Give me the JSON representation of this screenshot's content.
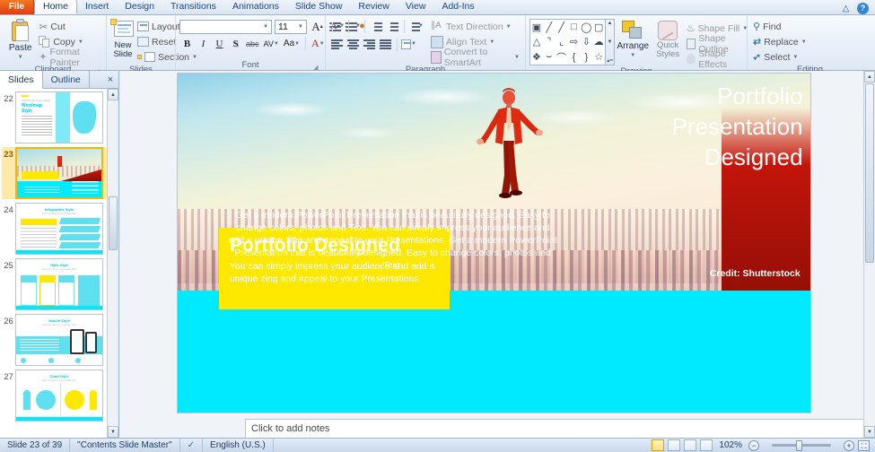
{
  "window": {
    "file_tab": "File",
    "minimize_ribbon_icon": "minimize-ribbon-icon",
    "help_icon": "help-icon"
  },
  "ribbon": {
    "tabs": [
      {
        "label": "Home",
        "active": true
      },
      {
        "label": "Insert",
        "active": false
      },
      {
        "label": "Design",
        "active": false
      },
      {
        "label": "Transitions",
        "active": false
      },
      {
        "label": "Animations",
        "active": false
      },
      {
        "label": "Slide Show",
        "active": false
      },
      {
        "label": "Review",
        "active": false
      },
      {
        "label": "View",
        "active": false
      },
      {
        "label": "Add-Ins",
        "active": false
      }
    ],
    "groups": {
      "clipboard": {
        "label": "Clipboard",
        "paste": "Paste",
        "cut": "Cut",
        "copy": "Copy",
        "format_painter": "Format Painter"
      },
      "slides": {
        "label": "Slides",
        "new_slide": "New\nSlide",
        "new_slide_line1": "New",
        "new_slide_line2": "Slide",
        "layout": "Layout",
        "reset": "Reset",
        "section": "Section"
      },
      "font": {
        "label": "Font",
        "font_name": "",
        "font_size": "11",
        "bold": "B",
        "italic": "I",
        "underline": "U",
        "shadow": "S",
        "strikethrough": "abc",
        "character_spacing": "AV",
        "change_case": "Aa",
        "font_color": "A",
        "grow_font": "A",
        "shrink_font": "A",
        "clear_formatting": "clear-formatting-icon"
      },
      "paragraph": {
        "label": "Paragraph",
        "text_direction": "Text Direction",
        "align_text": "Align Text",
        "convert_to_smartart": "Convert to SmartArt"
      },
      "drawing": {
        "label": "Drawing",
        "arrange": "Arrange",
        "quick_styles_line1": "Quick",
        "quick_styles_line2": "Styles",
        "shape_fill": "Shape Fill",
        "shape_outline": "Shape Outline",
        "shape_effects": "Shape Effects"
      },
      "editing": {
        "label": "Editing",
        "find": "Find",
        "replace": "Replace",
        "select": "Select"
      }
    }
  },
  "left_panel": {
    "tabs": [
      {
        "label": "Slides",
        "active": true
      },
      {
        "label": "Outline",
        "active": false
      }
    ],
    "close_label": "×",
    "slides": [
      {
        "number": "22",
        "title": "Wordmap Style",
        "selected": false
      },
      {
        "number": "23",
        "title": "Portfolio Designed",
        "selected": true
      },
      {
        "number": "24",
        "title": "Infographic Style",
        "selected": false
      },
      {
        "number": "25",
        "title": "Table Style",
        "selected": false
      },
      {
        "number": "26",
        "title": "Mobile Style",
        "selected": false
      },
      {
        "number": "27",
        "title": "Chart Style",
        "selected": false
      }
    ],
    "thumb_subtitle": "Insert the title of your subtitle Here"
  },
  "slide": {
    "yellow_box": {
      "title": "Portfolio Designed",
      "body": "You can simply impress your audience and add a unique zing and appeal to your Presentations."
    },
    "credit": "Credit: Shutterstock",
    "cyan_body": "Get a modern PowerPoint  Presentation that is beautifully  designed. Easy to change colors, photos and Text. You can simply impress your audience and add a unique zing and appeal to your Presentations. Get a modern PowerPoint  Presentation that is beautifully  designed. Easy to change colors, photos and Text.",
    "big_lines": [
      "Portfolio",
      "Presentation",
      "Designed"
    ],
    "colors": {
      "yellow": "#ffe800",
      "cyan": "#00eaff",
      "red": "#c3150a",
      "white": "#ffffff"
    }
  },
  "notes": {
    "placeholder": "Click to add notes"
  },
  "status_bar": {
    "slide_counter": "Slide 23 of 39",
    "theme": "\"Contents Slide Master\"",
    "spell_icon": "spell-check-icon",
    "language": "English (U.S.)",
    "zoom_level": "102%",
    "views": [
      {
        "name": "normal-view",
        "active": true
      },
      {
        "name": "slide-sorter-view",
        "active": false
      },
      {
        "name": "reading-view",
        "active": false
      },
      {
        "name": "slide-show-view",
        "active": false
      }
    ],
    "zoom_out": "−",
    "zoom_in": "+",
    "fit_to_window": "fit-slide-icon"
  }
}
